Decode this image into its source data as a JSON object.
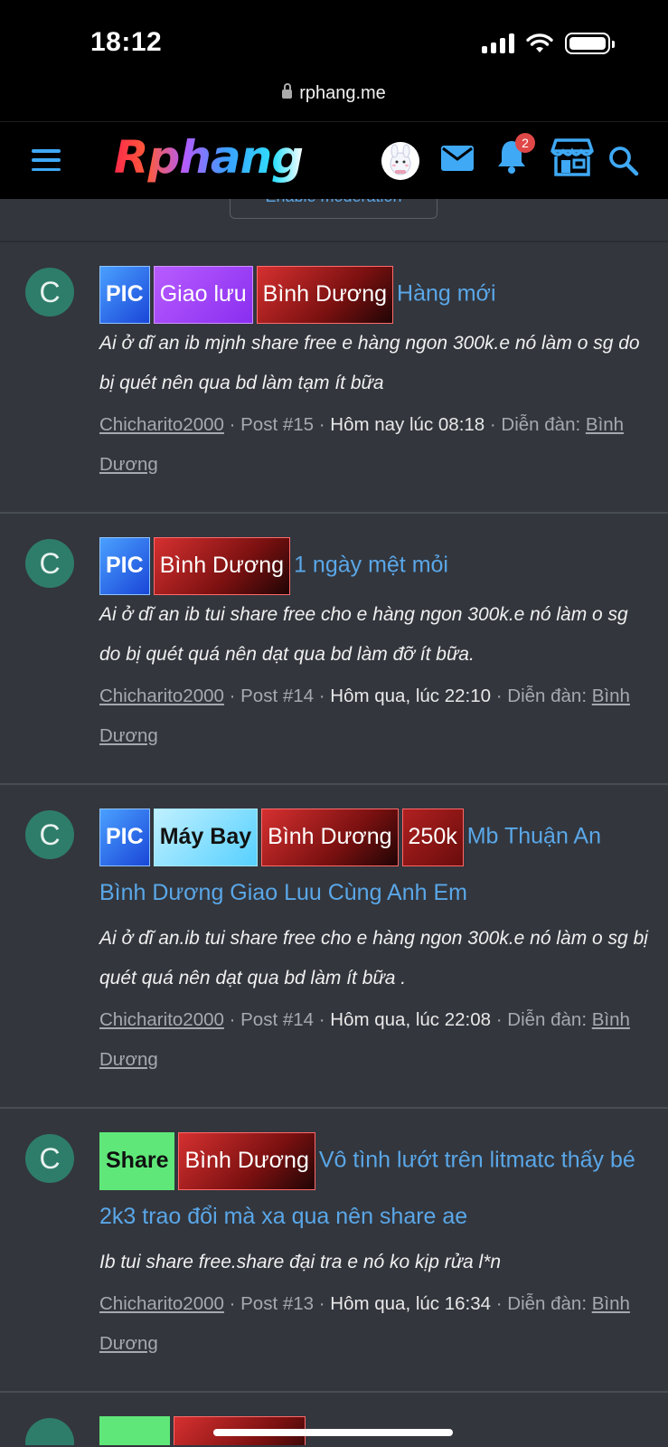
{
  "status": {
    "time": "18:12",
    "url": "rphang.me"
  },
  "header": {
    "logo": "Rphang",
    "notification_count": "2",
    "icons": [
      "menu-icon",
      "avatar",
      "mail-icon",
      "bell-icon",
      "store-icon",
      "search-icon"
    ]
  },
  "moderation_button": "Enable moderation",
  "colors": {
    "accent": "#3fa9f5",
    "link": "#5aa7e8",
    "background": "#33363d",
    "avatar": "#2e7d6a"
  },
  "results": [
    {
      "avatar_letter": "C",
      "tags": [
        "PIC",
        "Giao lưu",
        "Bình Dương"
      ],
      "title": "Hàng mới",
      "snippet": "Ai ở dĩ an ib mjnh share free e hàng ngon 300k.e nó làm o sg do bị quét nên qua bd làm tạm ít bữa",
      "author": "Chicharito2000",
      "post": "Post #15",
      "date": "Hôm nay lúc 08:18",
      "forum_label": "Diễn đàn:",
      "forum": "Bình Dương"
    },
    {
      "avatar_letter": "C",
      "tags": [
        "PIC",
        "Bình Dương"
      ],
      "title": "1 ngày mệt mỏi",
      "snippet": "Ai ở dĩ an ib tui share free cho e hàng ngon 300k.e nó làm o sg do bị quét quá nên dạt qua bd làm đỡ ít bữa.",
      "author": "Chicharito2000",
      "post": "Post #14",
      "date": "Hôm qua, lúc 22:10",
      "forum_label": "Diễn đàn:",
      "forum": "Bình Dương"
    },
    {
      "avatar_letter": "C",
      "tags": [
        "PIC",
        "Máy Bay",
        "Bình Dương",
        "250k"
      ],
      "title": "Mb Thuận An Bình Dương Giao Luu Cùng Anh Em",
      "snippet": "Ai ở dĩ an.ib tui share free cho e hàng ngon 300k.e nó làm o sg bị quét quá nên dạt qua bd làm ít bữa .",
      "author": "Chicharito2000",
      "post": "Post #14",
      "date": "Hôm qua, lúc 22:08",
      "forum_label": "Diễn đàn:",
      "forum": "Bình Dương"
    },
    {
      "avatar_letter": "C",
      "tags": [
        "Share",
        "Bình Dương"
      ],
      "title": "Vô tình lướt trên litmatc thấy bé 2k3 trao đổi mà xa qua nên share ae",
      "snippet": "Ib tui share free.share đại tra e nó ko kịp rửa l*n",
      "author": "Chicharito2000",
      "post": "Post #13",
      "date": "Hôm qua, lúc 16:34",
      "forum_label": "Diễn đàn:",
      "forum": "Bình Dương"
    }
  ]
}
